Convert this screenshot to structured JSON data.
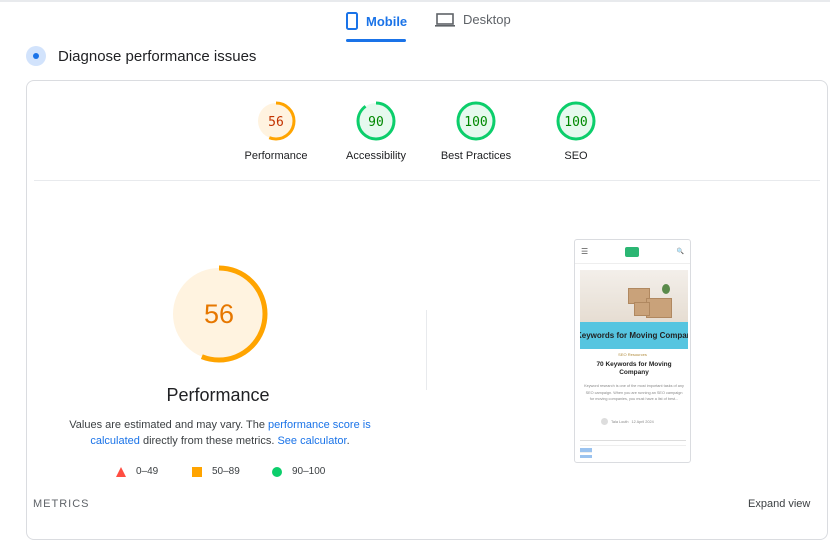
{
  "tabs": [
    {
      "label": "Mobile",
      "icon": "smartphone-icon",
      "active": true
    },
    {
      "label": "Desktop",
      "icon": "laptop-icon",
      "active": false
    }
  ],
  "section_title": "Diagnose performance issues",
  "scores": [
    {
      "label": "Performance",
      "value": 56,
      "color": "#ffa400",
      "text_color": "#c33300",
      "bg": "#fff3e0"
    },
    {
      "label": "Accessibility",
      "value": 90,
      "color": "#0cce6b",
      "text_color": "#008800",
      "bg": "#e6f9ee"
    },
    {
      "label": "Best Practices",
      "value": 100,
      "color": "#0cce6b",
      "text_color": "#008800",
      "bg": "#e6f9ee"
    },
    {
      "label": "SEO",
      "value": 100,
      "color": "#0cce6b",
      "text_color": "#008800",
      "bg": "#e6f9ee"
    }
  ],
  "main_gauge": {
    "value": 56,
    "title": "Performance",
    "color": "#ffa400",
    "text_color": "#e67700"
  },
  "note": {
    "prefix": "Values are estimated and may vary. The ",
    "link1": "performance score is calculated",
    "middle": " directly from these metrics. ",
    "link2": "See calculator",
    "suffix": "."
  },
  "legend": [
    {
      "range": "0–49",
      "shape": "triangle",
      "color": "#ff4e42"
    },
    {
      "range": "50–89",
      "shape": "square",
      "color": "#ffa400"
    },
    {
      "range": "90–100",
      "shape": "circle",
      "color": "#0cce6b"
    }
  ],
  "metrics_label": "METRICS",
  "expand_label": "Expand view",
  "screenshot": {
    "banner": "Keywords for Moving Company",
    "category": "SEO Resources",
    "title": "70 Keywords for Moving Company",
    "excerpt": "Keyword research is one of the most important tasks of any SEO campaign. When you are running an SEO campaign for moving companies, you must have a list of best...",
    "author": "Tala Louth",
    "date": "12 April 2024"
  }
}
